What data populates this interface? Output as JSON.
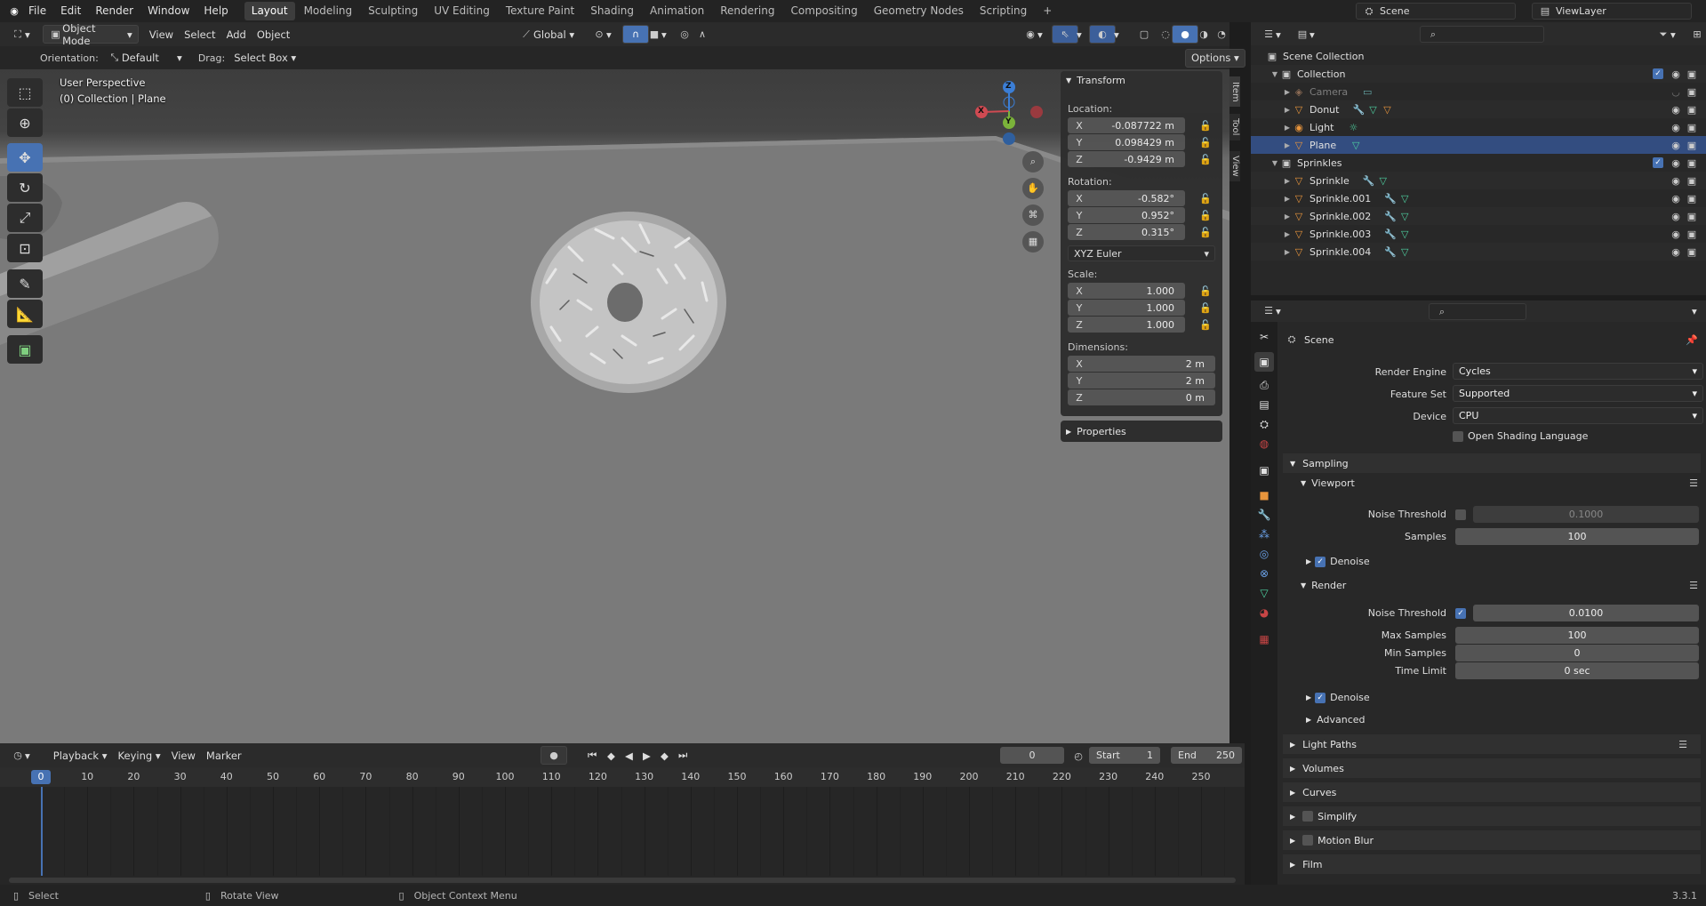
{
  "topbar": {
    "menus": [
      "File",
      "Edit",
      "Render",
      "Window",
      "Help"
    ],
    "workspaces": [
      "Layout",
      "Modeling",
      "Sculpting",
      "UV Editing",
      "Texture Paint",
      "Shading",
      "Animation",
      "Rendering",
      "Compositing",
      "Geometry Nodes",
      "Scripting"
    ],
    "add": "+",
    "scene": "Scene",
    "view_layer": "ViewLayer"
  },
  "viewport": {
    "mode": "Object Mode",
    "menus": [
      "View",
      "Select",
      "Add",
      "Object"
    ],
    "transform": "Global",
    "orientation_label": "Orientation:",
    "orientation": "Default",
    "drag_label": "Drag:",
    "drag": "Select Box",
    "options": "Options",
    "info_line1": "User Perspective",
    "info_line2": "(0) Collection | Plane",
    "gizmo": {
      "x": "X",
      "y": "Y",
      "z": "Z"
    },
    "side_tabs": [
      "Item",
      "Tool",
      "View"
    ]
  },
  "npanel": {
    "transform": "Transform",
    "location": "Location:",
    "rotation": "Rotation:",
    "scale": "Scale:",
    "dimensions": "Dimensions:",
    "loc": [
      [
        "X",
        "-0.087722 m"
      ],
      [
        "Y",
        "0.098429 m"
      ],
      [
        "Z",
        "-0.9429 m"
      ]
    ],
    "rot": [
      [
        "X",
        "-0.582°"
      ],
      [
        "Y",
        "0.952°"
      ],
      [
        "Z",
        "0.315°"
      ]
    ],
    "rot_mode": "XYZ Euler",
    "scl": [
      [
        "X",
        "1.000"
      ],
      [
        "Y",
        "1.000"
      ],
      [
        "Z",
        "1.000"
      ]
    ],
    "dim": [
      [
        "X",
        "2 m"
      ],
      [
        "Y",
        "2 m"
      ],
      [
        "Z",
        "0 m"
      ]
    ],
    "properties": "Properties"
  },
  "timeline": {
    "menus": [
      "Playback",
      "Keying",
      "View",
      "Marker"
    ],
    "frame": "0",
    "start_label": "Start",
    "start": "1",
    "end_label": "End",
    "end": "250",
    "ticks": [
      "0",
      "10",
      "20",
      "30",
      "40",
      "50",
      "60",
      "70",
      "80",
      "90",
      "100",
      "110",
      "120",
      "130",
      "140",
      "150",
      "160",
      "170",
      "180",
      "190",
      "200",
      "210",
      "220",
      "230",
      "240",
      "250"
    ]
  },
  "status": {
    "select": "Select",
    "rotate": "Rotate View",
    "context": "Object Context Menu",
    "version": "3.3.1"
  },
  "outliner": {
    "scene_collection": "Scene Collection",
    "collection": "Collection",
    "camera": "Camera",
    "donut": "Donut",
    "light": "Light",
    "plane": "Plane",
    "sprinkles": "Sprinkles",
    "sprinkle_items": [
      "Sprinkle",
      "Sprinkle.001",
      "Sprinkle.002",
      "Sprinkle.003",
      "Sprinkle.004"
    ]
  },
  "props": {
    "context": "Scene",
    "render_engine_label": "Render Engine",
    "render_engine": "Cycles",
    "feature_set_label": "Feature Set",
    "feature_set": "Supported",
    "device_label": "Device",
    "device": "CPU",
    "osl": "Open Shading Language",
    "sampling": "Sampling",
    "viewport": "Viewport",
    "noise_threshold": "Noise Threshold",
    "vp_noise": "0.1000",
    "samples": "Samples",
    "vp_samples": "100",
    "denoise": "Denoise",
    "render": "Render",
    "r_noise": "0.0100",
    "max_samples": "Max Samples",
    "r_max": "100",
    "min_samples": "Min Samples",
    "r_min": "0",
    "time_limit": "Time Limit",
    "r_time": "0 sec",
    "advanced": "Advanced",
    "light_paths": "Light Paths",
    "volumes": "Volumes",
    "curves": "Curves",
    "simplify": "Simplify",
    "motion_blur": "Motion Blur",
    "film": "Film"
  }
}
